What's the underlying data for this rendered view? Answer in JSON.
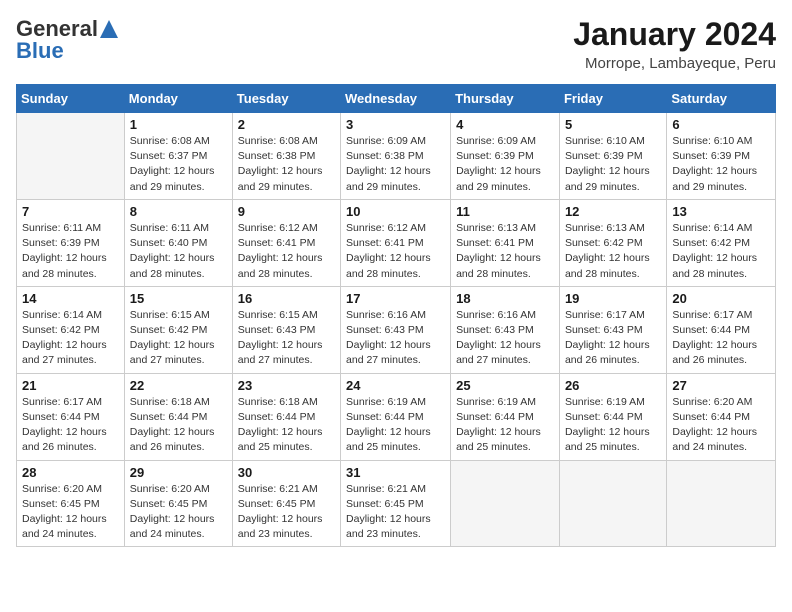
{
  "header": {
    "logo_general": "General",
    "logo_blue": "Blue",
    "title": "January 2024",
    "location": "Morrope, Lambayeque, Peru"
  },
  "days_of_week": [
    "Sunday",
    "Monday",
    "Tuesday",
    "Wednesday",
    "Thursday",
    "Friday",
    "Saturday"
  ],
  "weeks": [
    [
      {
        "day": "",
        "info": ""
      },
      {
        "day": "1",
        "info": "Sunrise: 6:08 AM\nSunset: 6:37 PM\nDaylight: 12 hours\nand 29 minutes."
      },
      {
        "day": "2",
        "info": "Sunrise: 6:08 AM\nSunset: 6:38 PM\nDaylight: 12 hours\nand 29 minutes."
      },
      {
        "day": "3",
        "info": "Sunrise: 6:09 AM\nSunset: 6:38 PM\nDaylight: 12 hours\nand 29 minutes."
      },
      {
        "day": "4",
        "info": "Sunrise: 6:09 AM\nSunset: 6:39 PM\nDaylight: 12 hours\nand 29 minutes."
      },
      {
        "day": "5",
        "info": "Sunrise: 6:10 AM\nSunset: 6:39 PM\nDaylight: 12 hours\nand 29 minutes."
      },
      {
        "day": "6",
        "info": "Sunrise: 6:10 AM\nSunset: 6:39 PM\nDaylight: 12 hours\nand 29 minutes."
      }
    ],
    [
      {
        "day": "7",
        "info": "Sunrise: 6:11 AM\nSunset: 6:39 PM\nDaylight: 12 hours\nand 28 minutes."
      },
      {
        "day": "8",
        "info": "Sunrise: 6:11 AM\nSunset: 6:40 PM\nDaylight: 12 hours\nand 28 minutes."
      },
      {
        "day": "9",
        "info": "Sunrise: 6:12 AM\nSunset: 6:41 PM\nDaylight: 12 hours\nand 28 minutes."
      },
      {
        "day": "10",
        "info": "Sunrise: 6:12 AM\nSunset: 6:41 PM\nDaylight: 12 hours\nand 28 minutes."
      },
      {
        "day": "11",
        "info": "Sunrise: 6:13 AM\nSunset: 6:41 PM\nDaylight: 12 hours\nand 28 minutes."
      },
      {
        "day": "12",
        "info": "Sunrise: 6:13 AM\nSunset: 6:42 PM\nDaylight: 12 hours\nand 28 minutes."
      },
      {
        "day": "13",
        "info": "Sunrise: 6:14 AM\nSunset: 6:42 PM\nDaylight: 12 hours\nand 28 minutes."
      }
    ],
    [
      {
        "day": "14",
        "info": "Sunrise: 6:14 AM\nSunset: 6:42 PM\nDaylight: 12 hours\nand 27 minutes."
      },
      {
        "day": "15",
        "info": "Sunrise: 6:15 AM\nSunset: 6:42 PM\nDaylight: 12 hours\nand 27 minutes."
      },
      {
        "day": "16",
        "info": "Sunrise: 6:15 AM\nSunset: 6:43 PM\nDaylight: 12 hours\nand 27 minutes."
      },
      {
        "day": "17",
        "info": "Sunrise: 6:16 AM\nSunset: 6:43 PM\nDaylight: 12 hours\nand 27 minutes."
      },
      {
        "day": "18",
        "info": "Sunrise: 6:16 AM\nSunset: 6:43 PM\nDaylight: 12 hours\nand 27 minutes."
      },
      {
        "day": "19",
        "info": "Sunrise: 6:17 AM\nSunset: 6:43 PM\nDaylight: 12 hours\nand 26 minutes."
      },
      {
        "day": "20",
        "info": "Sunrise: 6:17 AM\nSunset: 6:44 PM\nDaylight: 12 hours\nand 26 minutes."
      }
    ],
    [
      {
        "day": "21",
        "info": "Sunrise: 6:17 AM\nSunset: 6:44 PM\nDaylight: 12 hours\nand 26 minutes."
      },
      {
        "day": "22",
        "info": "Sunrise: 6:18 AM\nSunset: 6:44 PM\nDaylight: 12 hours\nand 26 minutes."
      },
      {
        "day": "23",
        "info": "Sunrise: 6:18 AM\nSunset: 6:44 PM\nDaylight: 12 hours\nand 25 minutes."
      },
      {
        "day": "24",
        "info": "Sunrise: 6:19 AM\nSunset: 6:44 PM\nDaylight: 12 hours\nand 25 minutes."
      },
      {
        "day": "25",
        "info": "Sunrise: 6:19 AM\nSunset: 6:44 PM\nDaylight: 12 hours\nand 25 minutes."
      },
      {
        "day": "26",
        "info": "Sunrise: 6:19 AM\nSunset: 6:44 PM\nDaylight: 12 hours\nand 25 minutes."
      },
      {
        "day": "27",
        "info": "Sunrise: 6:20 AM\nSunset: 6:44 PM\nDaylight: 12 hours\nand 24 minutes."
      }
    ],
    [
      {
        "day": "28",
        "info": "Sunrise: 6:20 AM\nSunset: 6:45 PM\nDaylight: 12 hours\nand 24 minutes."
      },
      {
        "day": "29",
        "info": "Sunrise: 6:20 AM\nSunset: 6:45 PM\nDaylight: 12 hours\nand 24 minutes."
      },
      {
        "day": "30",
        "info": "Sunrise: 6:21 AM\nSunset: 6:45 PM\nDaylight: 12 hours\nand 23 minutes."
      },
      {
        "day": "31",
        "info": "Sunrise: 6:21 AM\nSunset: 6:45 PM\nDaylight: 12 hours\nand 23 minutes."
      },
      {
        "day": "",
        "info": ""
      },
      {
        "day": "",
        "info": ""
      },
      {
        "day": "",
        "info": ""
      }
    ]
  ]
}
